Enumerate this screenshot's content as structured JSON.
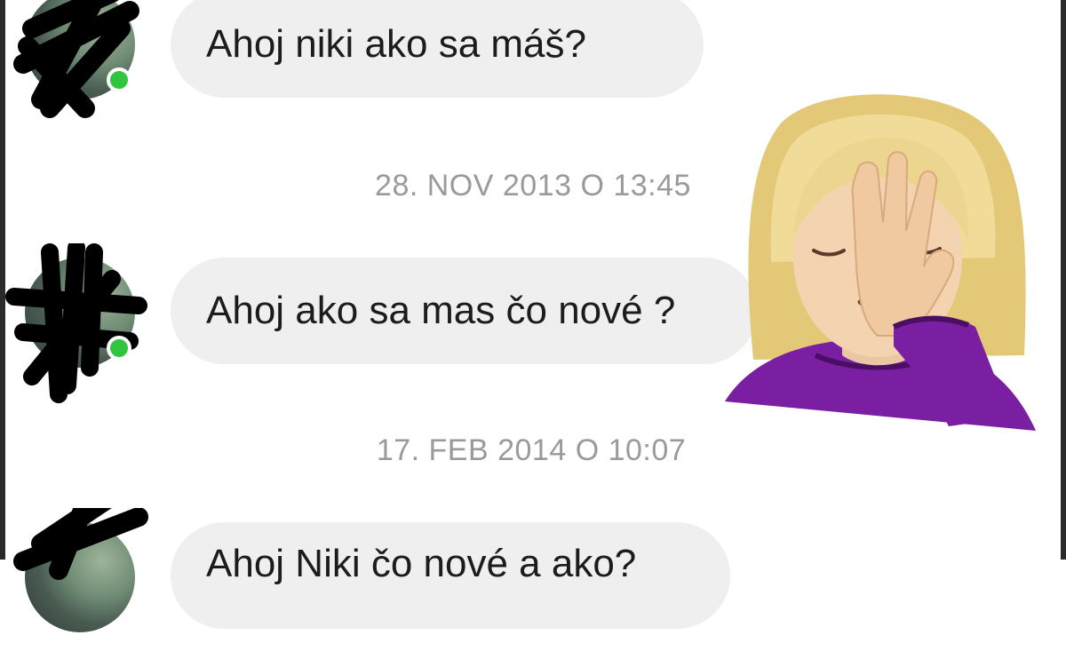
{
  "conversation": {
    "messages": [
      {
        "text": "Ahoj niki ako sa máš?",
        "status": "online"
      },
      {
        "text": "Ahoj ako sa mas čo nové ?",
        "status": "online"
      },
      {
        "text": "Ahoj Niki čo nové a ako?",
        "status": "online"
      }
    ],
    "timestamps": [
      "28. NOV 2013 O 13:45",
      "17. FEB 2014 O 10:07"
    ]
  },
  "overlay": {
    "emoji": "woman-facepalming-icon"
  },
  "colors": {
    "bubble": "#efefef",
    "online": "#31c53f",
    "timestamp": "#9a9a9a",
    "shirt": "#7b1fa2",
    "hair": "#ead48a"
  }
}
